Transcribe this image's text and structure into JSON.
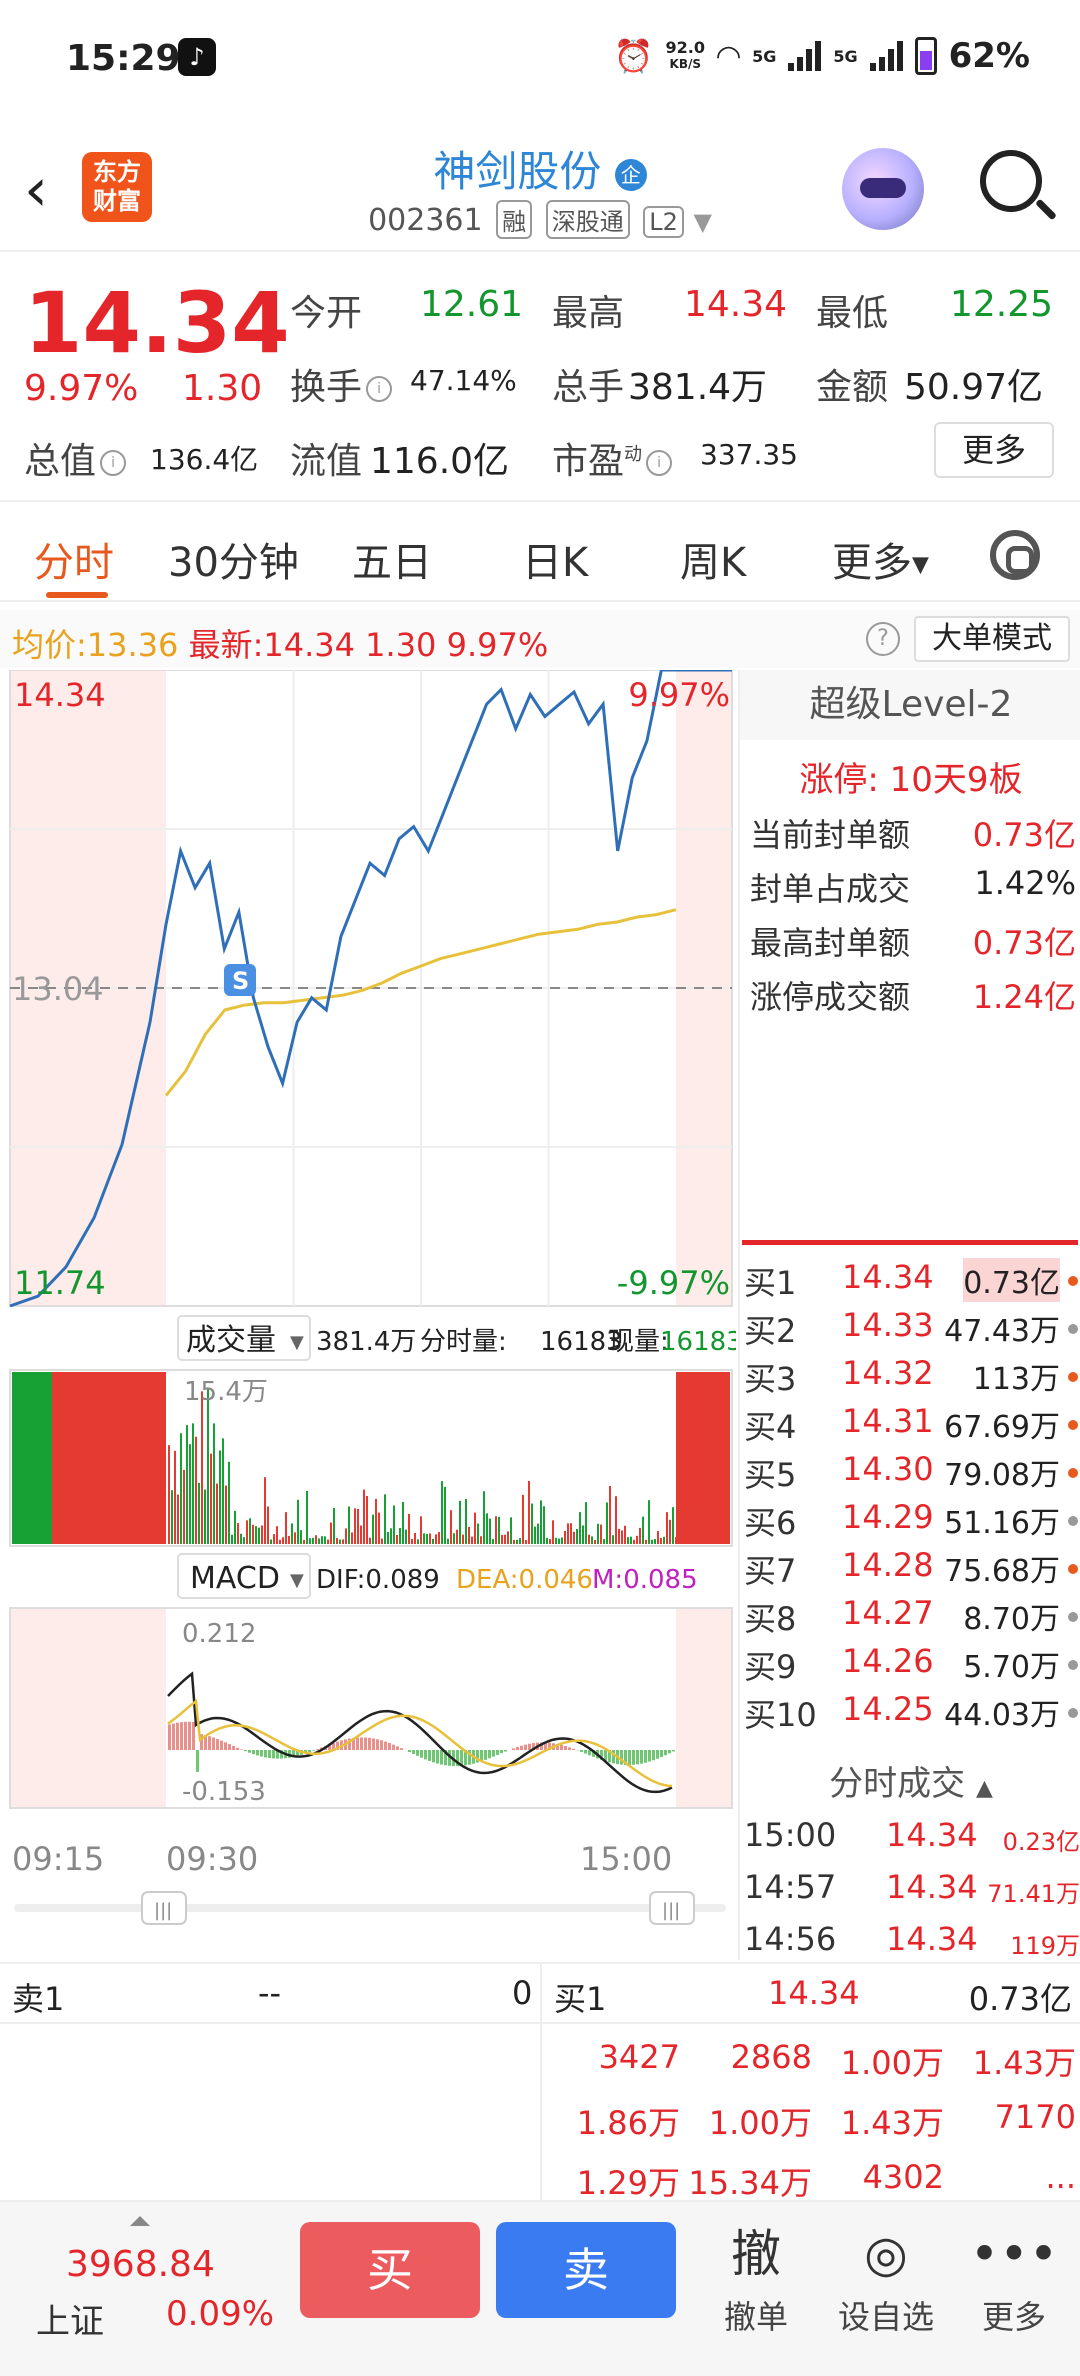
{
  "status": {
    "time": "15:29",
    "speed_top": "92.0",
    "speed_unit": "KB/S",
    "net1": "5G",
    "net2": "5G",
    "battery": "62%"
  },
  "header": {
    "logo_line1": "东方",
    "logo_line2": "财富",
    "stock_name": "神剑股份",
    "name_badge": "企",
    "code": "002361",
    "tags": [
      "融",
      "深股通",
      "L2"
    ]
  },
  "quote": {
    "price": "14.34",
    "pct": "9.97%",
    "change": "1.30",
    "open_label": "今开",
    "open": "12.61",
    "high_label": "最高",
    "high": "14.34",
    "low_label": "最低",
    "low": "12.25",
    "turnover_label": "换手",
    "turnover": "47.14%",
    "volume_label": "总手",
    "volume": "381.4万",
    "amount_label": "金额",
    "amount": "50.97亿",
    "mcap_label": "总值",
    "mcap": "136.4亿",
    "float_label": "流值",
    "float": "116.0亿",
    "pe_label": "市盈",
    "pe_sup": "动",
    "pe": "337.35",
    "more": "更多"
  },
  "tabs": {
    "items": [
      "分时",
      "30分钟",
      "五日",
      "日K",
      "周K",
      "更多"
    ],
    "active": "分时"
  },
  "avg": {
    "avg_label": "均价:",
    "avg": "13.36",
    "latest_label": "最新:",
    "latest": "14.34",
    "change": "1.30",
    "pct": "9.97%",
    "help": "?",
    "mode_button": "大单模式"
  },
  "chart_data": [
    {
      "type": "line",
      "name": "intraday",
      "ylim": [
        11.74,
        14.34
      ],
      "ref_price": "13.04",
      "top_left_label": "14.34",
      "bottom_left_label": "11.74",
      "top_right_label": "9.97%",
      "bottom_right_label": "-9.97%",
      "x_labels": [
        "09:15",
        "09:30",
        "15:00"
      ],
      "marker": "S",
      "price_series": [
        11.74,
        11.78,
        11.9,
        12.1,
        12.4,
        12.9,
        13.3,
        13.6,
        13.45,
        13.55,
        13.2,
        13.35,
        13.0,
        12.8,
        12.65,
        12.9,
        13.0,
        12.95,
        13.25,
        13.4,
        13.55,
        13.5,
        13.65,
        13.7,
        13.6,
        13.75,
        13.9,
        14.05,
        14.2,
        14.26,
        14.1,
        14.24,
        14.15,
        14.2,
        14.25,
        14.12,
        14.2,
        13.6,
        13.9,
        14.05,
        14.34,
        14.34
      ],
      "avg_series": [
        12.6,
        12.7,
        12.85,
        12.95,
        12.97,
        12.98,
        12.98,
        12.99,
        13.0,
        13.01,
        13.03,
        13.06,
        13.1,
        13.13,
        13.16,
        13.18,
        13.2,
        13.22,
        13.24,
        13.26,
        13.27,
        13.28,
        13.3,
        13.31,
        13.33,
        13.34,
        13.36
      ]
    },
    {
      "type": "bar",
      "name": "volume",
      "selector": "成交量",
      "total": "381.4万",
      "per_min_label": "分时量:",
      "per_min": "16183",
      "now_label": "现量:",
      "now": "16183",
      "max_label": "15.4万"
    },
    {
      "type": "bar",
      "name": "macd",
      "selector": "MACD",
      "dif": "DIF:0.089",
      "dea": "DEA:0.046",
      "m": "M:0.085",
      "top_label": "0.212",
      "bottom_label": "-0.153"
    }
  ],
  "level2": {
    "title": "超级Level-2",
    "limit_up": "涨停: 10天9板",
    "stats": [
      {
        "label": "当前封单额",
        "value": "0.73亿",
        "color": "#e4262b"
      },
      {
        "label": "封单占成交",
        "value": "1.42%",
        "color": "#222222"
      },
      {
        "label": "最高封单额",
        "value": "0.73亿",
        "color": "#e4262b"
      },
      {
        "label": "涨停成交额",
        "value": "1.24亿",
        "color": "#e4262b"
      }
    ],
    "bids": [
      {
        "name": "买1",
        "price": "14.34",
        "vol": "0.73亿",
        "dot": "#e8591e"
      },
      {
        "name": "买2",
        "price": "14.33",
        "vol": "47.43万",
        "dot": "#999999"
      },
      {
        "name": "买3",
        "price": "14.32",
        "vol": "113万",
        "dot": "#e8591e"
      },
      {
        "name": "买4",
        "price": "14.31",
        "vol": "67.69万",
        "dot": "#e8591e"
      },
      {
        "name": "买5",
        "price": "14.30",
        "vol": "79.08万",
        "dot": "#e8591e"
      },
      {
        "name": "买6",
        "price": "14.29",
        "vol": "51.16万",
        "dot": "#999999"
      },
      {
        "name": "买7",
        "price": "14.28",
        "vol": "75.68万",
        "dot": "#e8591e"
      },
      {
        "name": "买8",
        "price": "14.27",
        "vol": "8.70万",
        "dot": "#999999"
      },
      {
        "name": "买9",
        "price": "14.26",
        "vol": "5.70万",
        "dot": "#999999"
      },
      {
        "name": "买10",
        "price": "14.25",
        "vol": "44.03万",
        "dot": "#999999"
      }
    ],
    "trades_title": "分时成交",
    "trades": [
      {
        "time": "15:00",
        "price": "14.34",
        "vol": "0.23亿"
      },
      {
        "time": "14:57",
        "price": "14.34",
        "vol": "71.41万"
      },
      {
        "time": "14:56",
        "price": "14.34",
        "vol": "119万"
      }
    ]
  },
  "depth": {
    "sell_label": "卖1",
    "sell_price": "--",
    "sell_vol": "0",
    "buy_label": "买1",
    "buy_price": "14.34",
    "buy_vol": "0.73亿",
    "grid": [
      [
        "3427",
        "2868",
        "1.00万",
        "1.43万"
      ],
      [
        "1.86万",
        "1.00万",
        "1.43万",
        "7170"
      ],
      [
        "1.29万",
        "15.34万",
        "4302",
        "..."
      ]
    ]
  },
  "bottom": {
    "index_value": "3968.84",
    "index_name": "上证",
    "index_pct": "0.09%",
    "buy": "买",
    "sell": "卖",
    "actions": [
      {
        "icon": "撤",
        "label": "撤单"
      },
      {
        "icon": "◎",
        "label": "设自选"
      },
      {
        "icon": "•••",
        "label": "更多"
      }
    ]
  }
}
